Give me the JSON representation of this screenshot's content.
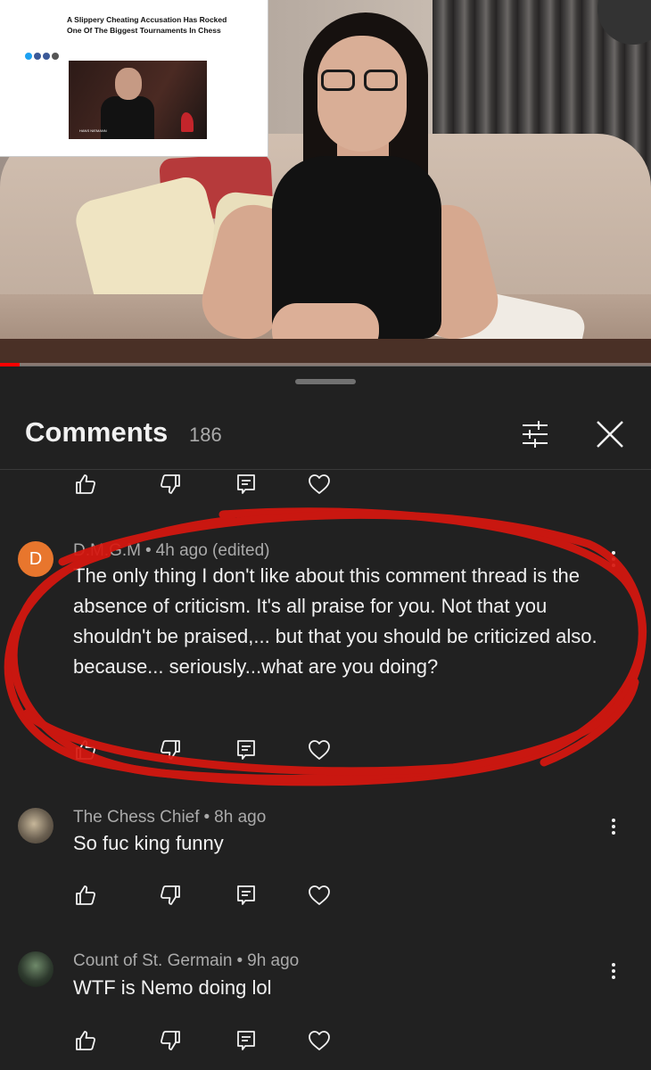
{
  "video": {
    "article": {
      "title": "A Slippery Cheating Accusation Has Rocked One Of The Biggest Tournaments In Chess",
      "lower_third": "HANS NIEMANN"
    },
    "progress_fraction": 0.03,
    "progress_color": "#ff0000"
  },
  "comments_panel": {
    "title": "Comments",
    "count": "186",
    "sort_icon": "sort-filter-icon",
    "close_icon": "close-icon",
    "actions": [
      "like-icon",
      "dislike-icon",
      "reply-icon",
      "heart-icon"
    ],
    "comments": [
      {
        "avatar_letter": "D",
        "author": "D.M.G.M",
        "time": "4h ago (edited)",
        "text": "The only thing I don't like about this comment thread is the absence of criticism. It's all praise for you. Not that you shouldn't be praised,... but that you should be criticized also. because... seriously...what are you doing?"
      },
      {
        "author": "The Chess Chief",
        "time": "8h ago",
        "text": "So fuc king funny"
      },
      {
        "author": "Count of St. Germain",
        "time": "9h ago",
        "text": "WTF is Nemo doing lol"
      }
    ]
  },
  "annotation_color": "#d8170f"
}
